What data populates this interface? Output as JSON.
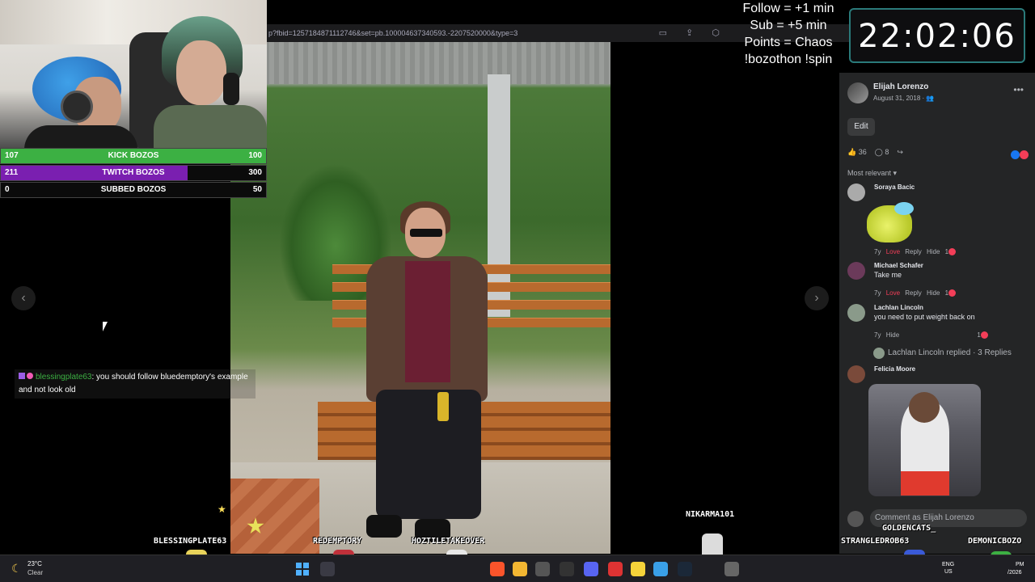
{
  "browser": {
    "url": "p?fbid=1257184871112746&set=pb.100004637340593.-2207520000&type=3"
  },
  "goals": [
    {
      "current": "107",
      "label": "KICK BOZOS",
      "target": "100",
      "color": "#3cb043",
      "progress": 1.0
    },
    {
      "current": "211",
      "label": "TWITCH BOZOS",
      "target": "300",
      "color": "#7a1fb0",
      "progress": 0.703
    },
    {
      "current": "0",
      "label": "SUBBED BOZOS",
      "target": "50",
      "color": "#c01020",
      "progress": 0.0
    }
  ],
  "chat": {
    "username": "blessingplate63",
    "message": ": you should follow bluedemptory's example and not look old"
  },
  "overlay": {
    "rules": [
      "Follow = +1 min",
      "Sub = +5 min",
      "Points = Chaos",
      "!bozothon !spin"
    ],
    "timer": "22:02:06"
  },
  "facebook": {
    "author": "Elijah Lorenzo",
    "date": "August 31, 2018 · ",
    "edit_label": "Edit",
    "likes": "36",
    "comments_count": "8",
    "sort_label": "Most relevant",
    "comments": [
      {
        "name": "Soraya Bacic",
        "text": "",
        "time": "7y",
        "reaction": "Love",
        "reply": "Reply",
        "hide": "Hide",
        "count": "1"
      },
      {
        "name": "Michael Schafer",
        "text": "Take me",
        "time": "7y",
        "reaction": "Love",
        "reply": "Reply",
        "hide": "Hide",
        "count": "1"
      },
      {
        "name": "Lachlan Lincoln",
        "text": "you need to put weight back on",
        "time": "7y",
        "reaction": "",
        "reply": "",
        "hide": "Hide",
        "count": "1"
      },
      {
        "name": "Felicia Moore",
        "text": "",
        "time": "",
        "reaction": "",
        "reply": "",
        "hide": "",
        "count": ""
      }
    ],
    "replies_summary": "Lachlan Lincoln replied · 3 Replies",
    "comment_placeholder": "Comment as Elijah Lorenzo"
  },
  "stream_names": {
    "blessingplate": "BLESSINGPLATE63",
    "redemptory": "REDEMPTORY",
    "hoztile": "HOZTILETAKEOVER",
    "nikarma": "NIKARMA101",
    "goldencats": "GOLDENCATS_",
    "strangled": "STRANGLEDROB63",
    "demonic": "DEMONICBOZO"
  },
  "taskbar": {
    "temp": "23°C",
    "weather": "Clear",
    "lang1": "ENG",
    "lang2": "US",
    "time": "PM",
    "date": "/2026"
  },
  "colors": {
    "fb_bg": "#242526",
    "timer_border": "#2a7a7a",
    "chat_username": "#3cb043"
  }
}
